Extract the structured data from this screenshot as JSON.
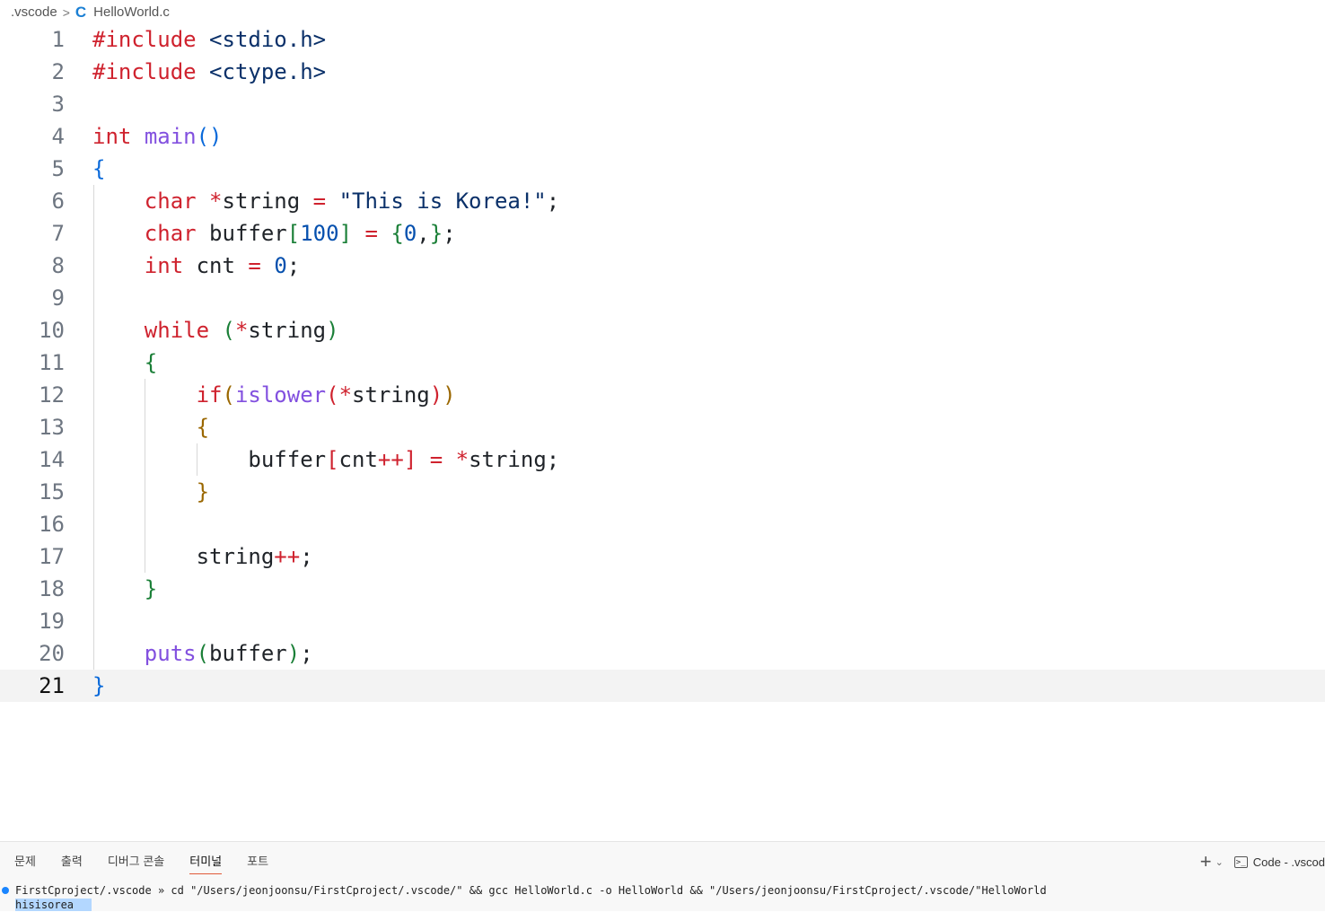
{
  "breadcrumb": {
    "folder": ".vscode",
    "file": "HelloWorld.c",
    "file_icon": "C"
  },
  "editor": {
    "current_line": 21,
    "lines": [
      {
        "n": "1",
        "tokens": [
          [
            "kw",
            "#include"
          ],
          [
            "id",
            " "
          ],
          [
            "str",
            "<stdio.h>"
          ]
        ]
      },
      {
        "n": "2",
        "tokens": [
          [
            "kw",
            "#include"
          ],
          [
            "id",
            " "
          ],
          [
            "str",
            "<ctype.h>"
          ]
        ]
      },
      {
        "n": "3",
        "tokens": []
      },
      {
        "n": "4",
        "tokens": [
          [
            "kw",
            "int"
          ],
          [
            "id",
            " "
          ],
          [
            "fn",
            "main"
          ],
          [
            "b1",
            "()"
          ]
        ]
      },
      {
        "n": "5",
        "tokens": [
          [
            "b1",
            "{"
          ]
        ]
      },
      {
        "n": "6",
        "tokens": [
          [
            "id",
            "    "
          ],
          [
            "kw",
            "char"
          ],
          [
            "id",
            " "
          ],
          [
            "op",
            "*"
          ],
          [
            "id",
            "string "
          ],
          [
            "op",
            "="
          ],
          [
            "id",
            " "
          ],
          [
            "str",
            "\"This is Korea!\""
          ],
          [
            "id",
            ";"
          ]
        ]
      },
      {
        "n": "7",
        "tokens": [
          [
            "id",
            "    "
          ],
          [
            "kw",
            "char"
          ],
          [
            "id",
            " buffer"
          ],
          [
            "b2",
            "["
          ],
          [
            "num",
            "100"
          ],
          [
            "b2",
            "]"
          ],
          [
            "id",
            " "
          ],
          [
            "op",
            "="
          ],
          [
            "id",
            " "
          ],
          [
            "b2",
            "{"
          ],
          [
            "num",
            "0"
          ],
          [
            "id",
            ","
          ],
          [
            "b2",
            "}"
          ],
          [
            "id",
            ";"
          ]
        ]
      },
      {
        "n": "8",
        "tokens": [
          [
            "id",
            "    "
          ],
          [
            "kw",
            "int"
          ],
          [
            "id",
            " cnt "
          ],
          [
            "op",
            "="
          ],
          [
            "id",
            " "
          ],
          [
            "num",
            "0"
          ],
          [
            "id",
            ";"
          ]
        ]
      },
      {
        "n": "9",
        "tokens": []
      },
      {
        "n": "10",
        "tokens": [
          [
            "id",
            "    "
          ],
          [
            "kw",
            "while"
          ],
          [
            "id",
            " "
          ],
          [
            "b2",
            "("
          ],
          [
            "op",
            "*"
          ],
          [
            "id",
            "string"
          ],
          [
            "b2",
            ")"
          ]
        ]
      },
      {
        "n": "11",
        "tokens": [
          [
            "id",
            "    "
          ],
          [
            "b2",
            "{"
          ]
        ]
      },
      {
        "n": "12",
        "tokens": [
          [
            "id",
            "        "
          ],
          [
            "kw",
            "if"
          ],
          [
            "b3",
            "("
          ],
          [
            "fn",
            "islower"
          ],
          [
            "kw",
            "("
          ],
          [
            "op",
            "*"
          ],
          [
            "id",
            "string"
          ],
          [
            "kw",
            ")"
          ],
          [
            "b3",
            ")"
          ]
        ]
      },
      {
        "n": "13",
        "tokens": [
          [
            "id",
            "        "
          ],
          [
            "b3",
            "{"
          ]
        ]
      },
      {
        "n": "14",
        "tokens": [
          [
            "id",
            "            buffer"
          ],
          [
            "kw",
            "["
          ],
          [
            "id",
            "cnt"
          ],
          [
            "op",
            "++"
          ],
          [
            "kw",
            "]"
          ],
          [
            "id",
            " "
          ],
          [
            "op",
            "="
          ],
          [
            "id",
            " "
          ],
          [
            "op",
            "*"
          ],
          [
            "id",
            "string;"
          ]
        ]
      },
      {
        "n": "15",
        "tokens": [
          [
            "id",
            "        "
          ],
          [
            "b3",
            "}"
          ]
        ]
      },
      {
        "n": "16",
        "tokens": []
      },
      {
        "n": "17",
        "tokens": [
          [
            "id",
            "        string"
          ],
          [
            "op",
            "++"
          ],
          [
            "id",
            ";"
          ]
        ]
      },
      {
        "n": "18",
        "tokens": [
          [
            "id",
            "    "
          ],
          [
            "b2",
            "}"
          ]
        ]
      },
      {
        "n": "19",
        "tokens": []
      },
      {
        "n": "20",
        "tokens": [
          [
            "id",
            "    "
          ],
          [
            "fn",
            "puts"
          ],
          [
            "b2",
            "("
          ],
          [
            "id",
            "buffer"
          ],
          [
            "b2",
            ")"
          ],
          [
            "id",
            ";"
          ]
        ]
      },
      {
        "n": "21",
        "tokens": [
          [
            "b1",
            "}"
          ]
        ]
      }
    ]
  },
  "panel": {
    "tabs": [
      "문제",
      "출력",
      "디버그 콘솔",
      "터미널",
      "포트"
    ],
    "active_tab": "터미널",
    "new_terminal_label": "+",
    "dropdown_label": "⌄",
    "terminal_name": "Code - .vscod",
    "terminal_lines": [
      "FirstCproject/.vscode » cd \"/Users/jeonjoonsu/FirstCproject/.vscode/\" && gcc HelloWorld.c -o HelloWorld && \"/Users/jeonjoonsu/FirstCproject/.vscode/\"HelloWorld",
      "hisisorea"
    ]
  },
  "colors": {
    "keyword": "#cf222e",
    "function": "#8250df",
    "string": "#0a3069",
    "number": "#0550ae",
    "bracket_level1": "#0969da",
    "bracket_level2": "#1a7f37",
    "bracket_level3": "#9a6700",
    "status_dot": "#1a85ff",
    "active_tab_underline": "#e05a3a"
  }
}
